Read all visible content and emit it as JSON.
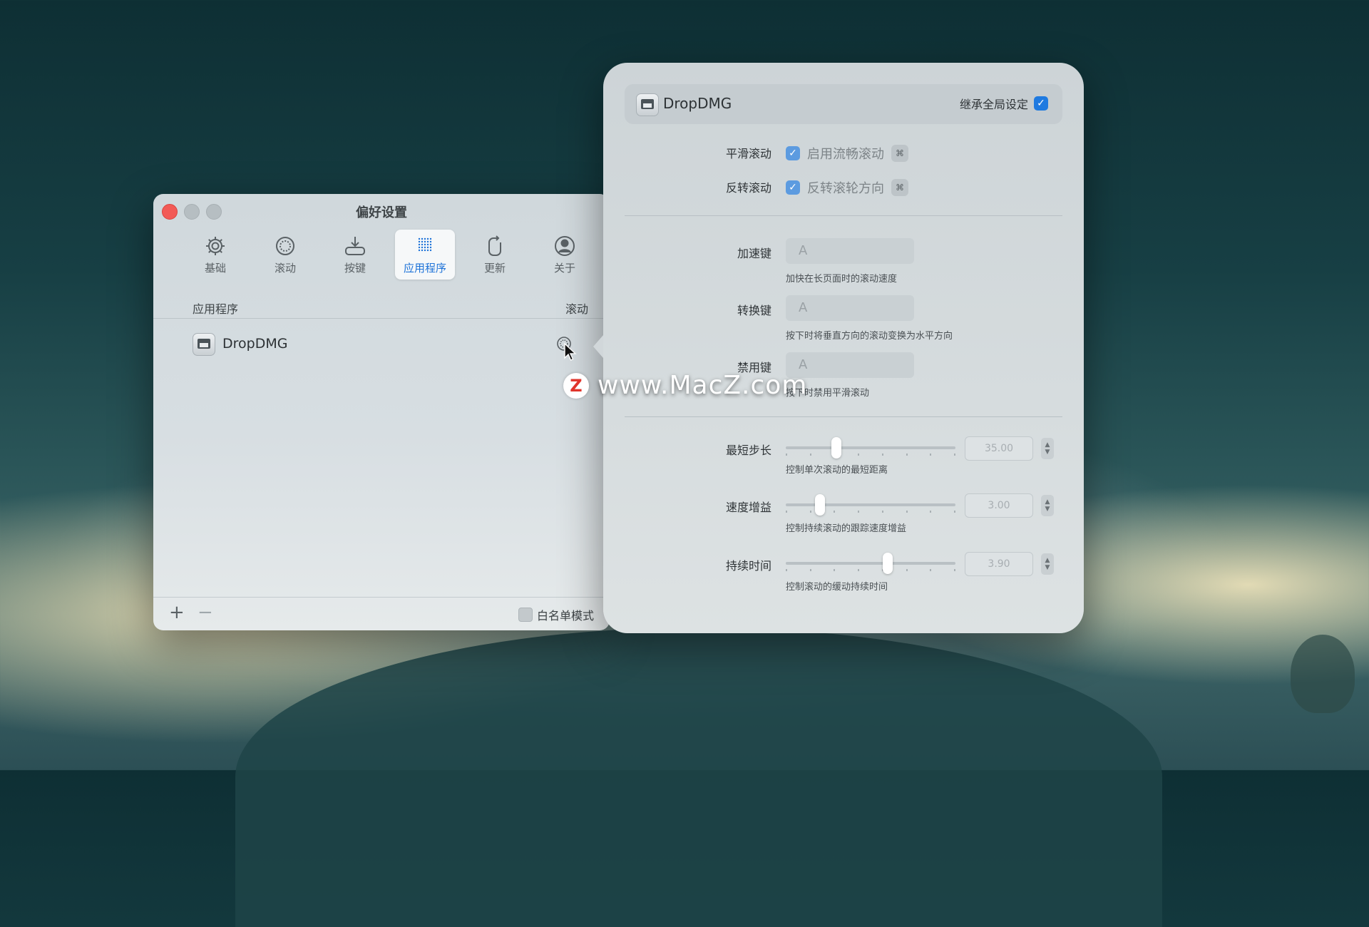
{
  "window": {
    "title": "偏好设置",
    "toolbar": [
      {
        "label": "基础",
        "icon": "gear-icon"
      },
      {
        "label": "滚动",
        "icon": "scroll-icon"
      },
      {
        "label": "按键",
        "icon": "keys-icon"
      },
      {
        "label": "应用程序",
        "icon": "apps-grid-icon",
        "active": true
      },
      {
        "label": "更新",
        "icon": "update-icon"
      },
      {
        "label": "关于",
        "icon": "about-icon"
      }
    ],
    "columns": {
      "app": "应用程序",
      "scroll": "滚动"
    },
    "rows": [
      {
        "name": "DropDMG"
      }
    ],
    "footer": {
      "add": "+",
      "remove": "−",
      "whitelist": "白名单模式",
      "whitelist_checked": false
    }
  },
  "popover": {
    "app_name": "DropDMG",
    "inherit_label": "继承全局设定",
    "inherit_checked": true,
    "smooth_label": "平滑滚动",
    "smooth_option": "启用流畅滚动",
    "reverse_label": "反转滚动",
    "reverse_option": "反转滚轮方向",
    "accel_label": "加速键",
    "accel_value": "A",
    "accel_hint": "加快在长页面时的滚动速度",
    "convert_label": "转换键",
    "convert_value": "A",
    "convert_hint": "按下时将垂直方向的滚动变换为水平方向",
    "disable_label": "禁用键",
    "disable_value": "A",
    "disable_hint": "按下时禁用平滑滚动",
    "step_label": "最短步长",
    "step_value": "35.00",
    "step_hint": "控制单次滚动的最短距离",
    "step_level": 0.3,
    "speed_label": "速度增益",
    "speed_value": "3.00",
    "speed_hint": "控制持续滚动的跟踪速度增益",
    "speed_level": 0.2,
    "duration_label": "持续时间",
    "duration_value": "3.90",
    "duration_hint": "控制滚动的缓动持续时间",
    "duration_level": 0.6
  },
  "watermark": {
    "badge": "Z",
    "text": "www.MacZ.com"
  },
  "colors": {
    "accent": "#1f7ae0",
    "close": "#f25a56"
  }
}
